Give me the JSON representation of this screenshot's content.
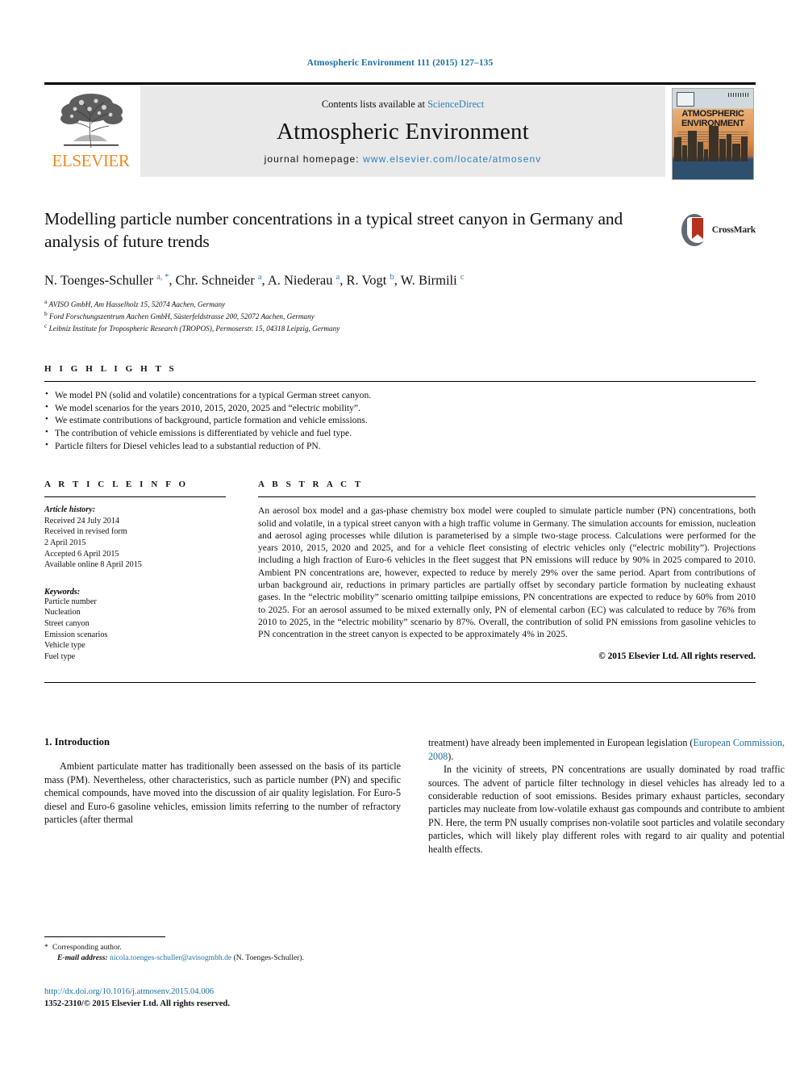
{
  "running_head": "Atmospheric Environment 111 (2015) 127–135",
  "masthead": {
    "publisher_name": "ELSEVIER",
    "contents_prefix": "Contents lists available at ",
    "contents_link": "ScienceDirect",
    "journal_title": "Atmospheric Environment",
    "homepage_label": "journal homepage: ",
    "homepage_url": "www.elsevier.com/locate/atmosenv",
    "cover_title_line1": "ATMOSPHERIC",
    "cover_title_line2": "ENVIRONMENT"
  },
  "article": {
    "title": "Modelling particle number concentrations in a typical street canyon in Germany and analysis of future trends",
    "crossmark_label": "CrossMark",
    "authors_html": "N. Toenges-Schuller <sup>a, *</sup>, Chr. Schneider <sup>a</sup>, A. Niederau <sup>a</sup>, R. Vogt <sup>b</sup>, W. Birmili <sup>c</sup>",
    "affiliations": [
      {
        "marker": "a",
        "text": "AVISO GmbH, Am Hasselholz 15, 52074 Aachen, Germany"
      },
      {
        "marker": "b",
        "text": "Ford Forschungszentrum Aachen GmbH, Süsterfeldstrasse 200, 52072 Aachen, Germany"
      },
      {
        "marker": "c",
        "text": "Leibniz Institute for Tropospheric Research (TROPOS), Permoserstr. 15, 04318 Leipzig, Germany"
      }
    ]
  },
  "highlights": {
    "heading": "H I G H L I G H T S",
    "items": [
      "We model PN (solid and volatile) concentrations for a typical German street canyon.",
      "We model scenarios for the years 2010, 2015, 2020, 2025 and “electric mobility”.",
      "We estimate contributions of background, particle formation and vehicle emissions.",
      "The contribution of vehicle emissions is differentiated by vehicle and fuel type.",
      "Particle filters for Diesel vehicles lead to a substantial reduction of PN."
    ]
  },
  "article_info": {
    "heading": "A R T I C L E   I N F O",
    "history_label": "Article history:",
    "history_lines": [
      "Received 24 July 2014",
      "Received in revised form",
      "2 April 2015",
      "Accepted 6 April 2015",
      "Available online 8 April 2015"
    ],
    "keywords_label": "Keywords:",
    "keywords": [
      "Particle number",
      "Nucleation",
      "Street canyon",
      "Emission scenarios",
      "Vehicle type",
      "Fuel type"
    ]
  },
  "abstract": {
    "heading": "A B S T R A C T",
    "text": "An aerosol box model and a gas-phase chemistry box model were coupled to simulate particle number (PN) concentrations, both solid and volatile, in a typical street canyon with a high traffic volume in Germany. The simulation accounts for emission, nucleation and aerosol aging processes while dilution is parameterised by a simple two-stage process. Calculations were performed for the years 2010, 2015, 2020 and 2025, and for a vehicle fleet consisting of electric vehicles only (“electric mobility”). Projections including a high fraction of Euro-6 vehicles in the fleet suggest that PN emissions will reduce by 90% in 2025 compared to 2010. Ambient PN concentrations are, however, expected to reduce by merely 29% over the same period. Apart from contributions of urban background air, reductions in primary particles are partially offset by secondary particle formation by nucleating exhaust gases. In the “electric mobility” scenario omitting tailpipe emissions, PN concentrations are expected to reduce by 60% from 2010 to 2025. For an aerosol assumed to be mixed externally only, PN of elemental carbon (EC) was calculated to reduce by 76% from 2010 to 2025, in the “electric mobility” scenario by 87%. Overall, the contribution of solid PN emissions from gasoline vehicles to PN concentration in the street canyon is expected to be approximately 4% in 2025.",
    "copyright": "© 2015 Elsevier Ltd. All rights reserved."
  },
  "introduction": {
    "heading": "1. Introduction",
    "left_paragraph": "Ambient particulate matter has traditionally been assessed on the basis of its particle mass (PM). Nevertheless, other characteristics, such as particle number (PN) and specific chemical compounds, have moved into the discussion of air quality legislation. For Euro-5 diesel and Euro-6 gasoline vehicles, emission limits referring to the number of refractory particles (after thermal",
    "right_paragraph_1_pre": "treatment) have already been implemented in European legislation (",
    "right_paragraph_1_link": "European Commission, 2008",
    "right_paragraph_1_post": ").",
    "right_paragraph_2": "In the vicinity of streets, PN concentrations are usually dominated by road traffic sources. The advent of particle filter technology in diesel vehicles has already led to a considerable reduction of soot emissions. Besides primary exhaust particles, secondary particles may nucleate from low-volatile exhaust gas compounds and contribute to ambient PN. Here, the term PN usually comprises non-volatile soot particles and volatile secondary particles, which will likely play different roles with regard to air quality and potential health effects."
  },
  "footnote": {
    "star": "*",
    "corresponding": "Corresponding author.",
    "email_label": "E-mail address:",
    "email": "nicola.toenges-schuller@avisogmbh.de",
    "email_suffix": "(N. Toenges-Schuller)."
  },
  "footer": {
    "doi": "http://dx.doi.org/10.1016/j.atmosenv.2015.04.006",
    "issn_line": "1352-2310/© 2015 Elsevier Ltd. All rights reserved."
  },
  "colors": {
    "link_blue": "#1a6fa3",
    "science_direct_blue": "#2e7fbb",
    "elsevier_orange": "#ed8b22",
    "crossmark_red": "#b5321d",
    "masthead_grey": "#e9e9e9"
  }
}
